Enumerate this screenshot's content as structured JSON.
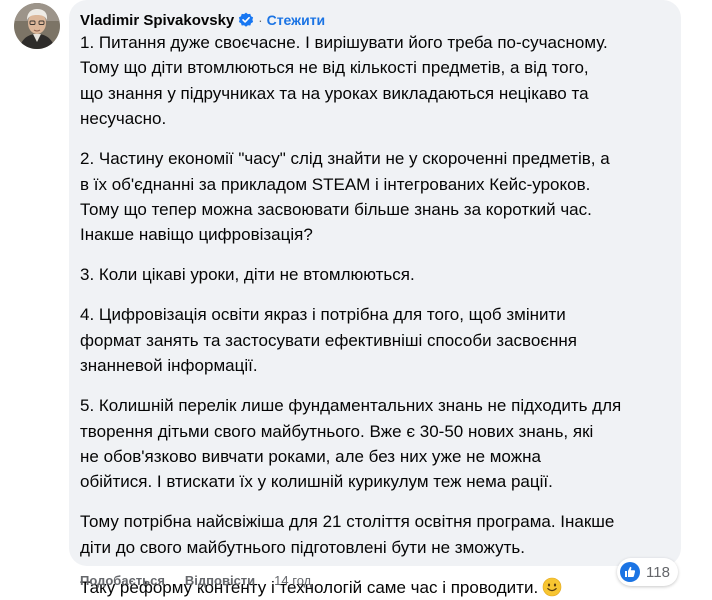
{
  "comment": {
    "author": "Vladimir Spivakovsky",
    "separator": "·",
    "follow_label": "Стежити",
    "paragraphs": [
      "1. Питання дуже своєчасне. І вирішувати його треба по-сучасному.\nТому що діти втомлюються не від кількості предметів, а від того,\nщо знання у підручниках та на уроках викладаються нецікаво та\nнесучасно.",
      "2. Частину економії \"часу\" слід знайти не у скороченні предметів, а\nв їх об'єднанні за прикладом STEAM і інтегрованих Кейс-уроков.\nТому що тепер можна засвоювати більше знань за короткий час.\nІнакше навіщо цифровізація?",
      "3. Коли цікаві уроки, діти не втомлюються.",
      "4. Цифровізація освіти якраз і потрібна для того, щоб змінити\nформат занять та застосувати ефективніші способи засвоєння\nзнанневой інформації.",
      "5. Колишній перелік лише фундаментальних знань не підходить для\nтворення дітьми свого майбутнього. Вже є 30-50 нових знань, які\nне обов'язково вивчати роками, але без них уже не можна\nобійтися. І втискати їх у колишній курикулум теж нема рації.",
      "Тому потрібна найсвіжіша для 21 століття освітня програма. Інакше\nдіти до свого майбутнього підготовлені бути не зможуть.",
      "Таку реформу контенту і технологій саме час і проводити."
    ],
    "emoji": "slightly-smiling-face-icon",
    "reactions": {
      "icon": "like-icon",
      "count": "118"
    },
    "actions": {
      "like_label": "Подобається",
      "reply_label": "Відповісти",
      "timestamp": "14 год"
    }
  },
  "colors": {
    "bubble_bg": "#f0f2f5",
    "text": "#050505",
    "secondary_text": "#65676b",
    "link_blue": "#1b74e4",
    "verified_blue": "#1877f2"
  }
}
